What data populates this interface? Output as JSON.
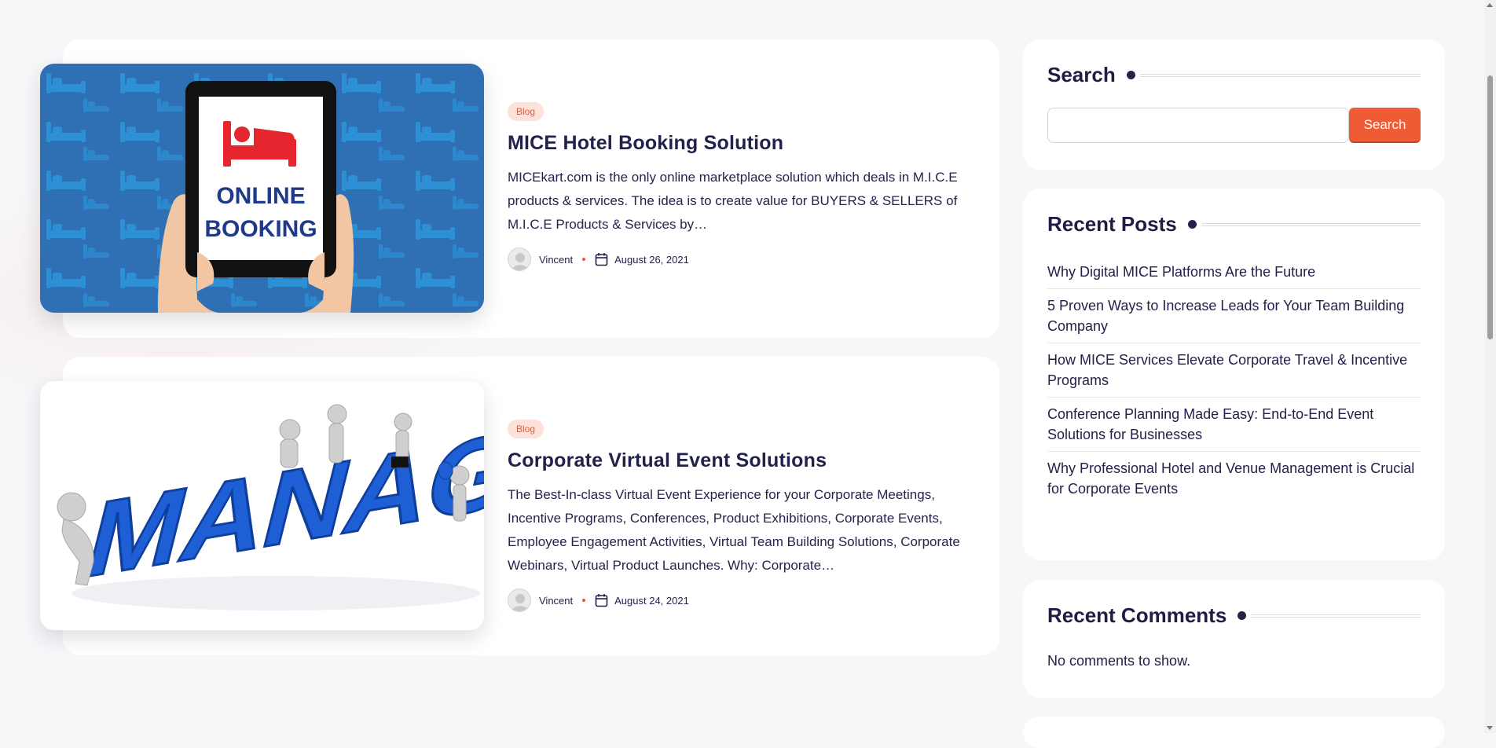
{
  "posts": [
    {
      "category": "Blog",
      "title": "MICE Hotel Booking Solution",
      "excerpt": "MICEkart.com is the only online marketplace solution which deals in M.I.C.E products & services. The idea is to create value for BUYERS & SELLERS of M.I.C.E Products & Services by…",
      "author": "Vincent",
      "date": "August 26, 2021",
      "image": {
        "line1": "ONLINE",
        "line2": "BOOKING",
        "icon": "bed-icon"
      }
    },
    {
      "category": "Blog",
      "title": "Corporate Virtual Event Solutions",
      "excerpt": "The Best-In-class Virtual Event Experience for your Corporate Meetings, Incentive Programs, Conferences, Product Exhibitions, Corporate Events, Employee Engagement Activities, Virtual Team Building Solutions, Corporate Webinars, Virtual Product Launches. Why: Corporate…",
      "author": "Vincent",
      "date": "August 24, 2021",
      "image": {
        "word": "MANAGE",
        "icon": "people-figures-icon"
      }
    }
  ],
  "sidebar": {
    "search": {
      "title": "Search",
      "placeholder": "",
      "button_label": "Search"
    },
    "recent_posts": {
      "title": "Recent Posts",
      "items": [
        "Why Digital MICE Platforms Are the Future",
        "5 Proven Ways to Increase Leads for Your Team Building Company",
        "How MICE Services Elevate Corporate Travel & Incentive Programs",
        "Conference Planning Made Easy: End-to-End Event Solutions for Businesses",
        "Why Professional Hotel and Venue Management is Crucial for Corporate Events"
      ]
    },
    "recent_comments": {
      "title": "Recent Comments",
      "empty_text": "No comments to show."
    }
  },
  "colors": {
    "accent": "#ef5b35",
    "heading": "#1f1d44",
    "badge_bg": "#fde2da",
    "badge_text": "#e35d3b",
    "page_bg": "#f6f7f9"
  }
}
